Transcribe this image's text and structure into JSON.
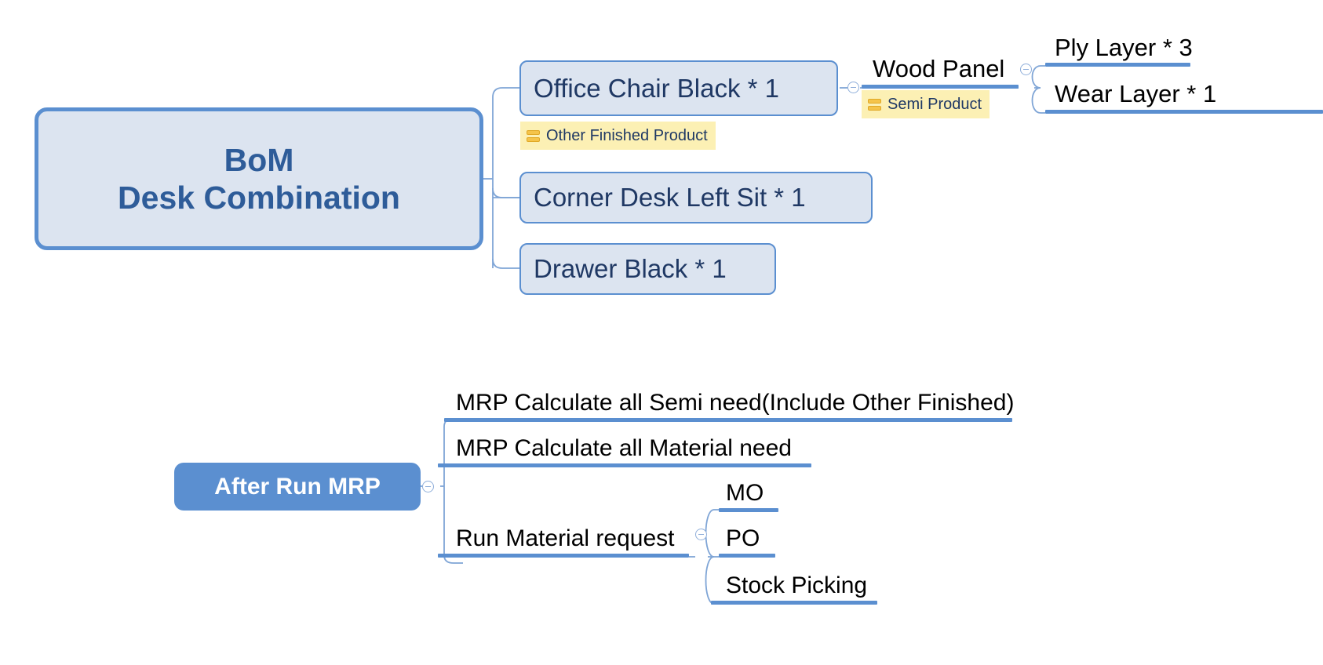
{
  "diagram": {
    "type": "mind-map",
    "title": "BoM Desk Combination / After Run MRP",
    "colors": {
      "accent_blue": "#5B8FD0",
      "node_fill": "#DCE4F0",
      "node_text": "#1F3864",
      "root_text": "#2E5C99",
      "note_fill": "#FCF0B4",
      "note_icon": "#F5C44A",
      "plain_text": "#000000",
      "background": "#FFFFFF"
    }
  },
  "map_bom": {
    "root": {
      "line1": "BoM",
      "line2": "Desk Combination"
    },
    "children": [
      {
        "label": "Office Chair Black * 1",
        "note": "Other Finished Product"
      },
      {
        "label": "Corner Desk Left Sit * 1"
      },
      {
        "label": "Drawer Black * 1"
      }
    ],
    "office_chair_children": [
      {
        "label": "Wood Panel",
        "note": "Semi Product"
      }
    ],
    "wood_panel_children": [
      {
        "label": "Ply Layer * 3"
      },
      {
        "label": "Wear Layer * 1"
      }
    ]
  },
  "map_mrp": {
    "root": {
      "label": "After Run MRP"
    },
    "children": [
      {
        "label": "MRP Calculate all Semi need(Include Other Finished)"
      },
      {
        "label": "MRP Calculate all Material need"
      },
      {
        "label": "Run Material request"
      }
    ],
    "material_request_children": [
      {
        "label": "MO"
      },
      {
        "label": "PO"
      },
      {
        "label": "Stock Picking"
      }
    ]
  },
  "icons": {
    "note_tag": "tag-lines-icon",
    "collapse": "collapse-minus-icon"
  }
}
